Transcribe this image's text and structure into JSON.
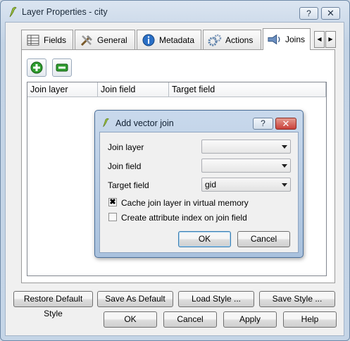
{
  "window": {
    "title": "Layer Properties - city",
    "help_button": "?",
    "close_button": "✕"
  },
  "tabs": [
    {
      "label": "Fields",
      "icon": "table-icon"
    },
    {
      "label": "General",
      "icon": "tools-icon"
    },
    {
      "label": "Metadata",
      "icon": "info-icon"
    },
    {
      "label": "Actions",
      "icon": "gears-icon"
    },
    {
      "label": "Joins",
      "icon": "join-icon"
    }
  ],
  "tab_scroll": {
    "left": "◀",
    "right": "▶"
  },
  "joins_table": {
    "columns": [
      "Join layer",
      "Join field",
      "Target field"
    ]
  },
  "add_button_icon": "plus-icon",
  "remove_button_icon": "minus-icon",
  "dialog": {
    "title": "Add vector join",
    "help_button": "?",
    "close_button": "✕",
    "join_layer_label": "Join layer",
    "join_layer_value": "",
    "join_field_label": "Join field",
    "join_field_value": "",
    "target_field_label": "Target field",
    "target_field_value": "gid",
    "cache_label": "Cache join layer in virtual memory",
    "cache_checked": true,
    "index_label": "Create attribute index on join field",
    "index_checked": false,
    "ok": "OK",
    "cancel": "Cancel"
  },
  "style_buttons": {
    "restore": "Restore Default Style",
    "save_default": "Save As Default",
    "load": "Load Style ...",
    "save": "Save Style ..."
  },
  "footer_buttons": {
    "ok": "OK",
    "cancel": "Cancel",
    "apply": "Apply",
    "help": "Help"
  },
  "colors": {
    "accent_red": "#c9403a",
    "title_bar": "#c3d3e5",
    "plus_green": "#2e9c2e"
  }
}
